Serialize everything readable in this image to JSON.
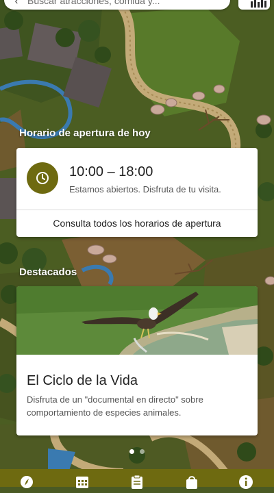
{
  "search": {
    "placeholder": "Buscar atracciones, comida y..."
  },
  "hours": {
    "section_title": "Horario de apertura de hoy",
    "time_range": "10:00 – 18:00",
    "status_text": "Estamos abiertos. Disfruta de tu visita.",
    "link_label": "Consulta todos los horarios de apertura"
  },
  "featured": {
    "section_title": "Destacados",
    "title": "El Ciclo de la Vida",
    "description": "Disfruta de un \"documental en directo\" sobre comportamiento de especies animales.",
    "image_subject": "fish eagle in flight over water"
  },
  "carousel": {
    "pages": 2,
    "active_index": 0
  },
  "bottom_nav": {
    "items": [
      {
        "icon": "compass-icon"
      },
      {
        "icon": "calendar-icon"
      },
      {
        "icon": "clipboard-icon"
      },
      {
        "icon": "shopping-bag-icon"
      },
      {
        "icon": "info-icon"
      }
    ]
  },
  "colors": {
    "accent": "#6e6a10",
    "card_bg": "#ffffff",
    "map_green": "#4e6a22",
    "map_path": "#b8a070",
    "water": "#3a7ab0"
  }
}
